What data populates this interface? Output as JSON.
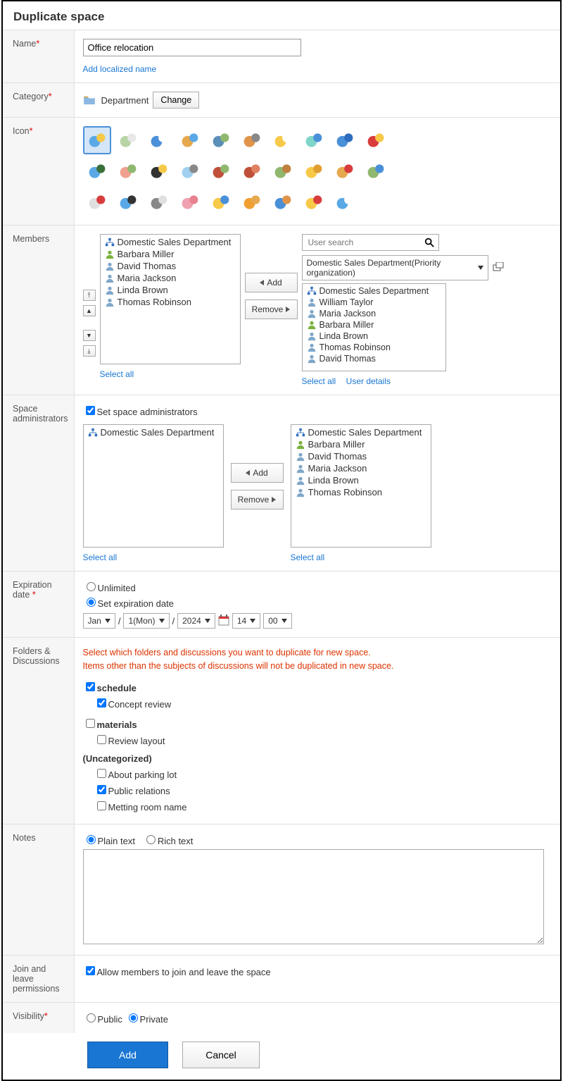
{
  "title": "Duplicate space",
  "labels": {
    "name": "Name",
    "category": "Category",
    "icon": "Icon",
    "members": "Members",
    "space_admins": "Space administrators",
    "expiration": "Expiration date ",
    "folders": "Folders & Discussions",
    "notes": "Notes",
    "join": "Join and leave permissions",
    "visibility": "Visibility"
  },
  "name": {
    "value": "Office relocation",
    "add_localized": "Add localized name"
  },
  "category": {
    "value": "Department",
    "change": "Change"
  },
  "members": {
    "left": [
      {
        "t": "org",
        "n": "Domestic Sales Department"
      },
      {
        "t": "g",
        "n": "Barbara Miller"
      },
      {
        "t": "u",
        "n": "David Thomas"
      },
      {
        "t": "u",
        "n": "Maria Jackson"
      },
      {
        "t": "u",
        "n": "Linda Brown"
      },
      {
        "t": "u",
        "n": "Thomas Robinson"
      }
    ],
    "search_ph": "User search",
    "org_picker": "Domestic Sales Department(Priority organization)",
    "right": [
      {
        "t": "org",
        "n": "Domestic Sales Department"
      },
      {
        "t": "u",
        "n": "William Taylor"
      },
      {
        "t": "u",
        "n": "Maria Jackson"
      },
      {
        "t": "g",
        "n": "Barbara Miller"
      },
      {
        "t": "u",
        "n": "Linda Brown"
      },
      {
        "t": "u",
        "n": "Thomas Robinson"
      },
      {
        "t": "u",
        "n": "David Thomas"
      }
    ],
    "add": "Add",
    "remove": "Remove",
    "select_all": "Select all",
    "user_details": "User details"
  },
  "admins": {
    "set_label": "Set space administrators",
    "left": [
      {
        "t": "org",
        "n": "Domestic Sales Department"
      }
    ],
    "right": [
      {
        "t": "org",
        "n": "Domestic Sales Department"
      },
      {
        "t": "g",
        "n": "Barbara Miller"
      },
      {
        "t": "u",
        "n": "David Thomas"
      },
      {
        "t": "u",
        "n": "Maria Jackson"
      },
      {
        "t": "u",
        "n": "Linda Brown"
      },
      {
        "t": "u",
        "n": "Thomas Robinson"
      }
    ],
    "add": "Add",
    "remove": "Remove",
    "select_all": "Select all"
  },
  "expiration": {
    "unlimited": "Unlimited",
    "set": "Set expiration date",
    "month": "Jan",
    "day": "1(Mon)",
    "year": "2024",
    "hour": "14",
    "min": "00"
  },
  "folders": {
    "note1": "Select which folders and discussions you want to duplicate for new space.",
    "note2": "Items other than the subjects of discussions will not be duplicated in new space.",
    "f1": {
      "name": "schedule",
      "d": "Concept review"
    },
    "f2": {
      "name": "materials",
      "d": "Review layout"
    },
    "uncat": "(Uncategorized)",
    "u1": "About parking lot",
    "u2": "Public relations",
    "u3": "Metting room name"
  },
  "notes": {
    "plain": "Plain text",
    "rich": "Rich text"
  },
  "join": {
    "allow": "Allow members to join and leave the space"
  },
  "visibility": {
    "pub": "Public",
    "priv": "Private"
  },
  "actions": {
    "add": "Add",
    "cancel": "Cancel"
  }
}
